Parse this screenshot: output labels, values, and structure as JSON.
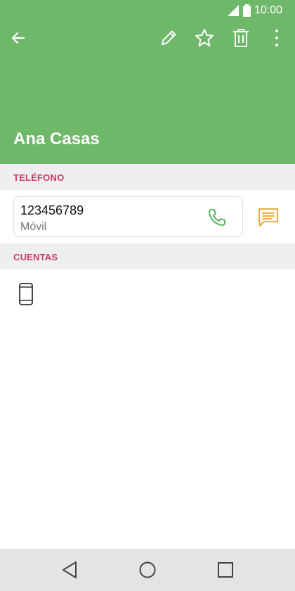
{
  "status_bar": {
    "time": "10:00"
  },
  "contact": {
    "name": "Ana Casas"
  },
  "sections": {
    "phone": {
      "title": "TELÉFONO"
    },
    "accounts": {
      "title": "CUENTAS"
    }
  },
  "phone_entry": {
    "number": "123456789",
    "type": "Móvil"
  },
  "icons": {
    "back": "arrow-left-icon",
    "edit": "pencil-icon",
    "favorite": "star-icon",
    "delete": "trash-icon",
    "more": "more-vertical-icon",
    "call": "phone-icon",
    "message": "message-icon",
    "account": "smartphone-icon"
  },
  "colors": {
    "header": "#6fb86a",
    "section_title": "#d2386c",
    "call_icon": "#4caf50",
    "message_icon": "#f0a030"
  }
}
